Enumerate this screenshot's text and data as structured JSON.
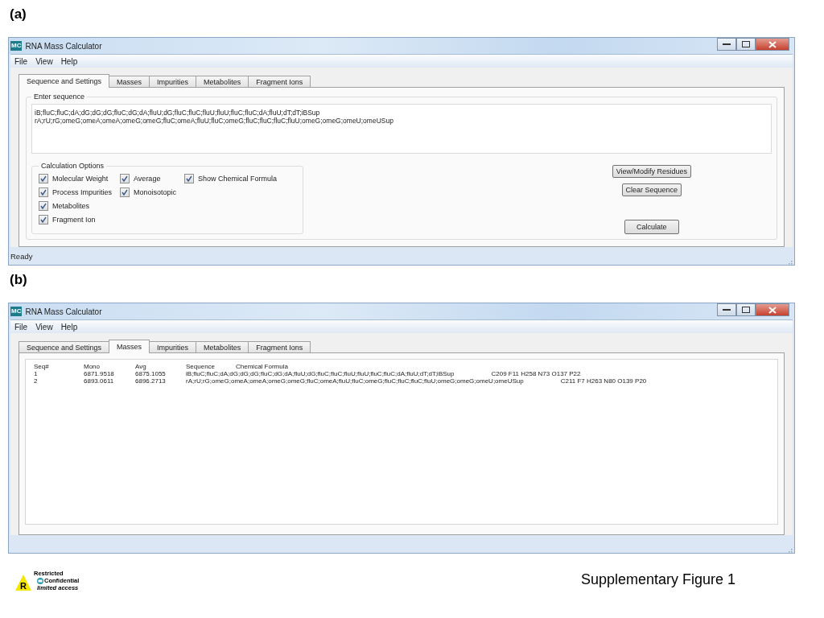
{
  "panels": [
    {
      "label": "(a)",
      "window": {
        "kind": "settings",
        "icon_text": "MC",
        "title": "RNA Mass Calculator",
        "menu": [
          "File",
          "View",
          "Help"
        ],
        "tabs": [
          {
            "label": "Sequence and Settings",
            "selected": true
          },
          {
            "label": "Masses",
            "selected": false
          },
          {
            "label": "Impurities",
            "selected": false
          },
          {
            "label": "Metabolites",
            "selected": false
          },
          {
            "label": "Fragment Ions",
            "selected": false
          }
        ],
        "sequence_group": {
          "title": "Enter sequence",
          "value": "iB;fluC;fluC;dA;dG;dG;dG;fluC;dG;dA;fluU;dG;fluC;fluC;fluU;fluU;fluC;fluC;dA;fluU;dT;dT;iBSup\nrA;rU;rG;omeG;omeA;omeA;omeG;omeG;fluC;omeA;fluU;fluC;omeG;fluC;fluC;fluC;fluU;omeG;omeG;omeU;omeUSup"
        },
        "options": {
          "title": "Calculation Options",
          "columns": [
            [
              {
                "label": "Molecular Weight",
                "checked": true
              },
              {
                "label": "Process Impurities",
                "checked": true
              },
              {
                "label": "Metabolites",
                "checked": true
              },
              {
                "label": "Fragment Ion",
                "checked": true
              }
            ],
            [
              {
                "label": "Average",
                "checked": true
              },
              {
                "label": "Monoisotopic",
                "checked": true
              }
            ],
            [
              {
                "label": "Show Chemical Formula",
                "checked": true
              }
            ]
          ]
        },
        "buttons": [
          "View/Modify Residues",
          "Clear Sequence",
          "Calculate"
        ],
        "status": "Ready"
      }
    },
    {
      "label": "(b)",
      "window": {
        "kind": "masses",
        "icon_text": "MC",
        "title": "RNA Mass Calculator",
        "menu": [
          "File",
          "View",
          "Help"
        ],
        "tabs": [
          {
            "label": "Sequence and Settings",
            "selected": false
          },
          {
            "label": "Masses",
            "selected": true
          },
          {
            "label": "Impurities",
            "selected": false
          },
          {
            "label": "Metabolites",
            "selected": false
          },
          {
            "label": "Fragment Ions",
            "selected": false
          }
        ],
        "results": {
          "header_labels": {
            "seq": "Seq#",
            "mono": "Mono",
            "avg": "Avg",
            "sequence": "Sequence",
            "formula": "Chemical Formula"
          },
          "entries": [
            {
              "seq": "1",
              "mono": "6871.9518",
              "avg": "6875.1055",
              "sequence": "iB;fluC;fluC;dA;dG;dG;dG;fluC;dG;dA;fluU;dG;fluC;fluC;fluU;fluU;fluC;fluC;dA;fluU;dT;dT;iBSup",
              "formula": "C209 F11 H258 N73 O137 P22"
            },
            {
              "seq": "2",
              "mono": "6893.0611",
              "avg": "6896.2713",
              "sequence": "rA;rU;rG;omeG;omeA;omeA;omeG;omeG;fluC;omeA;fluU;fluC;omeG;fluC;fluC;fluC;fluU;omeG;omeG;omeU;omeUSup",
              "formula": "C211 F7 H263 N80 O139 P20"
            }
          ]
        }
      }
    }
  ],
  "footer": {
    "stamp": {
      "letter": "R",
      "lines": [
        "Restricted",
        "Confidential",
        "limited access"
      ]
    },
    "caption": "Supplementary Figure 1"
  }
}
